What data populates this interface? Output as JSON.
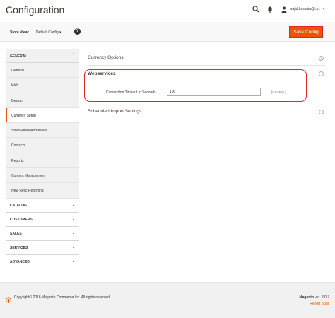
{
  "header": {
    "title": "Configuration",
    "user_name": "wajid.hussain@co..",
    "icons": [
      "search-icon",
      "bell-icon",
      "user-icon"
    ]
  },
  "scope": {
    "store_view_label": "Store View:",
    "store_view_value": "Default Config",
    "help_label": "?",
    "save_label": "Save Config"
  },
  "sidebar": {
    "general_label": "GENERAL",
    "general_items": [
      {
        "label": "General"
      },
      {
        "label": "Web"
      },
      {
        "label": "Design"
      },
      {
        "label": "Currency Setup"
      },
      {
        "label": "Store Email Addresses"
      },
      {
        "label": "Contacts"
      },
      {
        "label": "Reports"
      },
      {
        "label": "Content Management"
      },
      {
        "label": "New Relic Reporting"
      }
    ],
    "sections": [
      {
        "label": "CATALOG"
      },
      {
        "label": "CUSTOMERS"
      },
      {
        "label": "SALES"
      },
      {
        "label": "SERVICES"
      },
      {
        "label": "ADVANCED"
      }
    ]
  },
  "main": {
    "currency_options_title": "Currency Options",
    "webservicex_title": "Webservicex",
    "timeout_label": "Connection Timeout in Seconds",
    "timeout_value": "100",
    "timeout_scope": "[GLOBAL]",
    "scheduled_import_title": "Scheduled Import Settings"
  },
  "footer": {
    "copyright": "Copyright© 2016 Magento Commerce Inc. All rights reserved.",
    "version_brand": "Magento",
    "version_text": " ver. 2.0.7",
    "report_bugs": "Report Bugs"
  },
  "colors": {
    "accent": "#eb5202",
    "highlight": "#e22626"
  }
}
